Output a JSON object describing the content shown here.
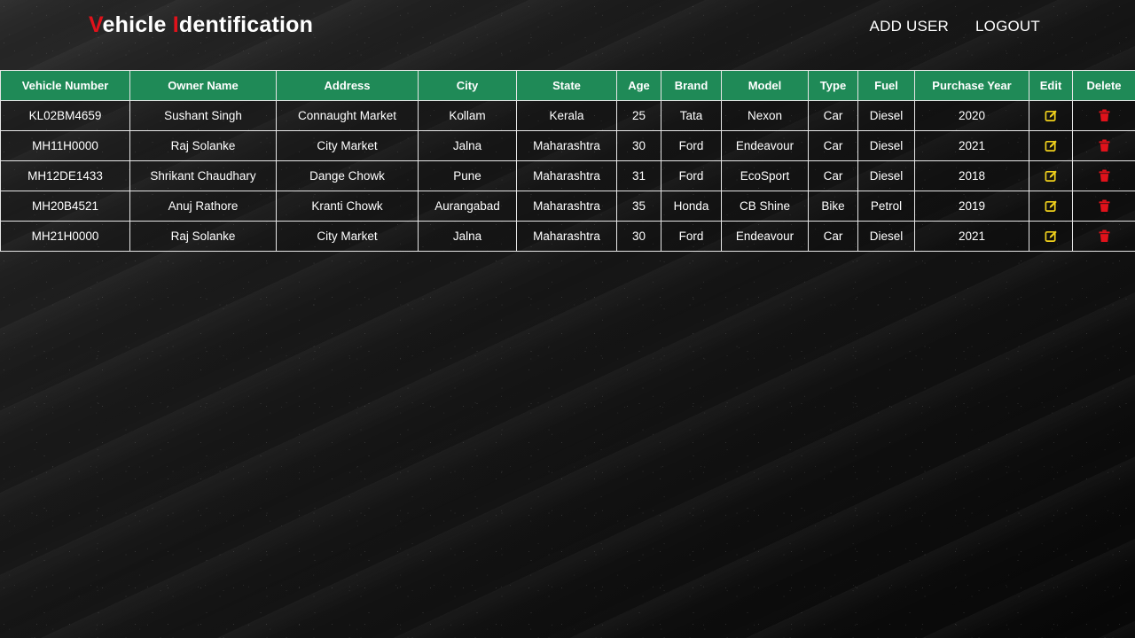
{
  "header": {
    "brand_first_initial": "V",
    "brand_first_rest": "ehicle ",
    "brand_second_initial": "I",
    "brand_second_rest": "dentification",
    "nav": {
      "add_user": "ADD USER",
      "logout": "LOGOUT"
    }
  },
  "colors": {
    "accent_red": "#e0121b",
    "header_green": "#1f8a57",
    "edit_icon": "#f2d21b",
    "delete_icon": "#e0121b"
  },
  "table": {
    "columns": [
      "Vehicle Number",
      "Owner Name",
      "Address",
      "City",
      "State",
      "Age",
      "Brand",
      "Model",
      "Type",
      "Fuel",
      "Purchase Year",
      "Edit",
      "Delete"
    ],
    "rows": [
      [
        "KL02BM4659",
        "Sushant Singh",
        "Connaught Market",
        "Kollam",
        "Kerala",
        "25",
        "Tata",
        "Nexon",
        "Car",
        "Diesel",
        "2020"
      ],
      [
        "MH11H0000",
        "Raj Solanke",
        "City Market",
        "Jalna",
        "Maharashtra",
        "30",
        "Ford",
        "Endeavour",
        "Car",
        "Diesel",
        "2021"
      ],
      [
        "MH12DE1433",
        "Shrikant Chaudhary",
        "Dange Chowk",
        "Pune",
        "Maharashtra",
        "31",
        "Ford",
        "EcoSport",
        "Car",
        "Diesel",
        "2018"
      ],
      [
        "MH20B4521",
        "Anuj Rathore",
        "Kranti Chowk",
        "Aurangabad",
        "Maharashtra",
        "35",
        "Honda",
        "CB Shine",
        "Bike",
        "Petrol",
        "2019"
      ],
      [
        "MH21H0000",
        "Raj Solanke",
        "City Market",
        "Jalna",
        "Maharashtra",
        "30",
        "Ford",
        "Endeavour",
        "Car",
        "Diesel",
        "2021"
      ]
    ],
    "edit_icon": "edit-icon",
    "delete_icon": "trash-icon"
  }
}
